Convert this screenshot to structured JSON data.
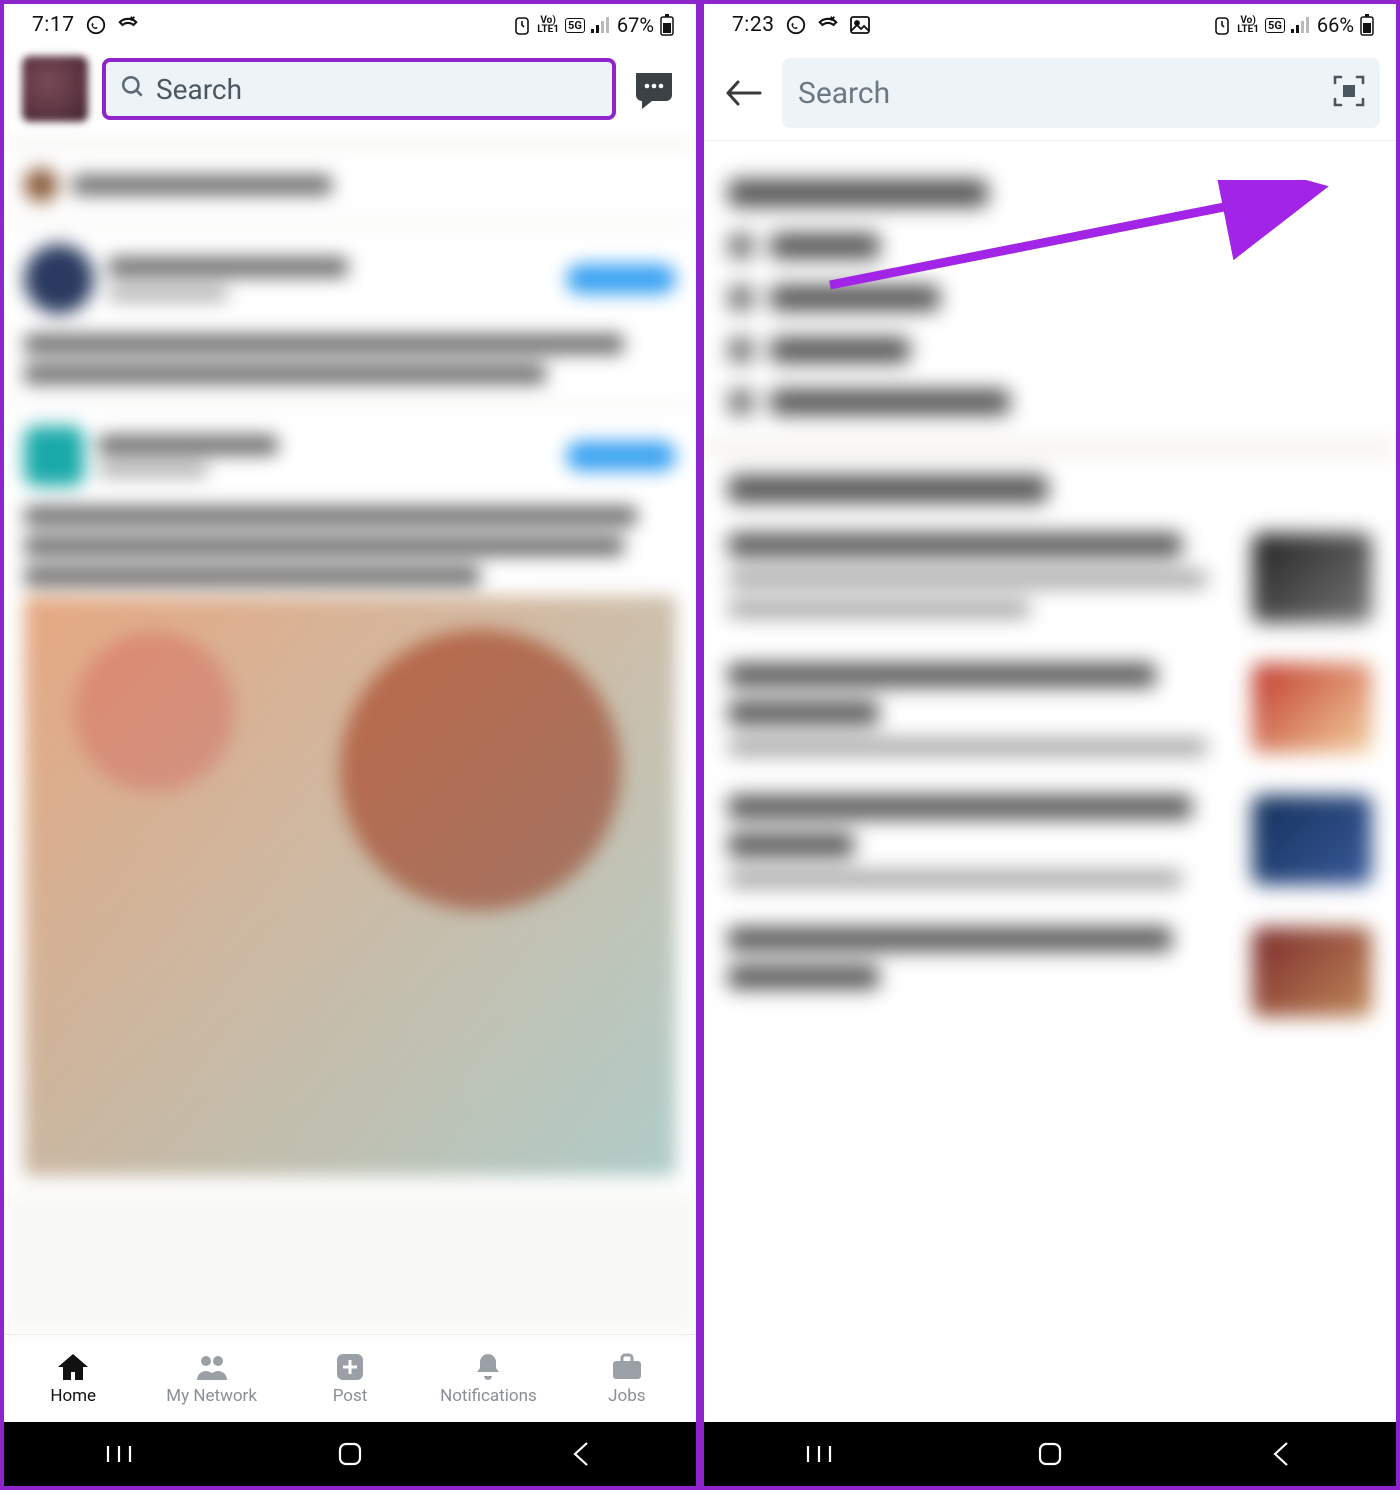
{
  "left": {
    "status": {
      "time": "7:17",
      "battery": "67%"
    },
    "search": {
      "placeholder": "Search"
    },
    "nav": {
      "home": "Home",
      "network": "My Network",
      "post": "Post",
      "notifications": "Notifications",
      "jobs": "Jobs"
    }
  },
  "right": {
    "status": {
      "time": "7:23",
      "battery": "66%"
    },
    "search": {
      "placeholder": "Search"
    }
  },
  "annotation": {
    "left_highlight": "search-bar",
    "right_arrow_target": "qr-scan-icon"
  }
}
